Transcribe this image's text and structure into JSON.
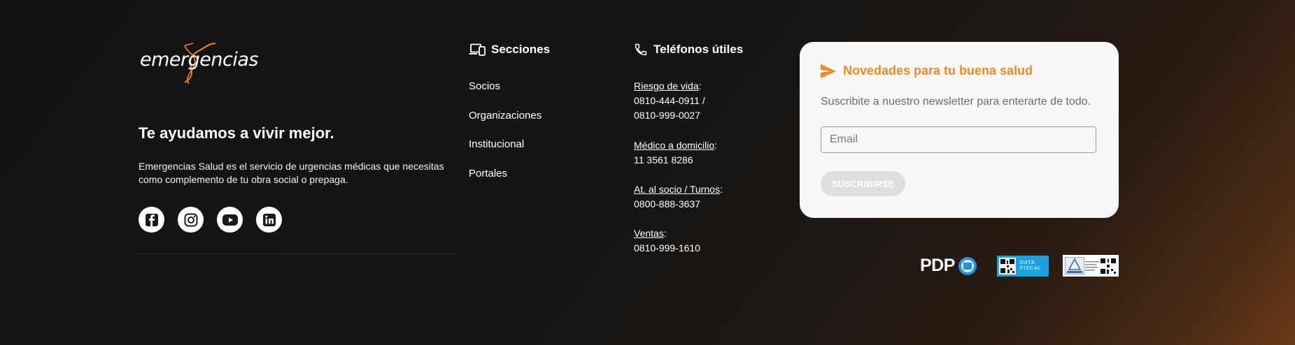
{
  "brand": {
    "logo_text": "emergencias",
    "tagline": "Te ayudamos a vivir mejor.",
    "description": "Emergencias Salud es el servicio de urgencias médicas que necesitas como complemento de tu obra social o prepaga.",
    "socials": [
      {
        "icon": "facebook-icon"
      },
      {
        "icon": "instagram-icon"
      },
      {
        "icon": "youtube-icon"
      },
      {
        "icon": "linkedin-icon"
      }
    ]
  },
  "secciones": {
    "heading": "Secciones",
    "icon": "devices-icon",
    "links": [
      "Socios",
      "Organizaciones",
      "Institucional",
      "Portales"
    ]
  },
  "telefonos": {
    "heading": "Teléfonos útiles",
    "icon": "phone-icon",
    "groups": [
      {
        "label": "Riesgo de vida",
        "numbers": [
          "0810-444-0911 /",
          "0810-999-0027"
        ]
      },
      {
        "label": "Médico a domicilio",
        "numbers": [
          "11 3561 8286"
        ]
      },
      {
        "label": "At. al socio / Turnos",
        "numbers": [
          "0800-888-3637"
        ]
      },
      {
        "label": "Ventas",
        "numbers": [
          "0810-999-1610"
        ]
      }
    ]
  },
  "newsletter": {
    "title": "Novedades para tu buena salud",
    "subtitle": "Suscribite a nuestro newsletter para enterarte de todo.",
    "email_placeholder": "Email",
    "button": "SUSCRIBIRSE"
  },
  "badges": {
    "pdp": "PDP",
    "datafiscal": "DATA FISCAL"
  },
  "colors": {
    "accent": "#f08a24",
    "background": "#161514",
    "card": "#f8f8f8"
  }
}
